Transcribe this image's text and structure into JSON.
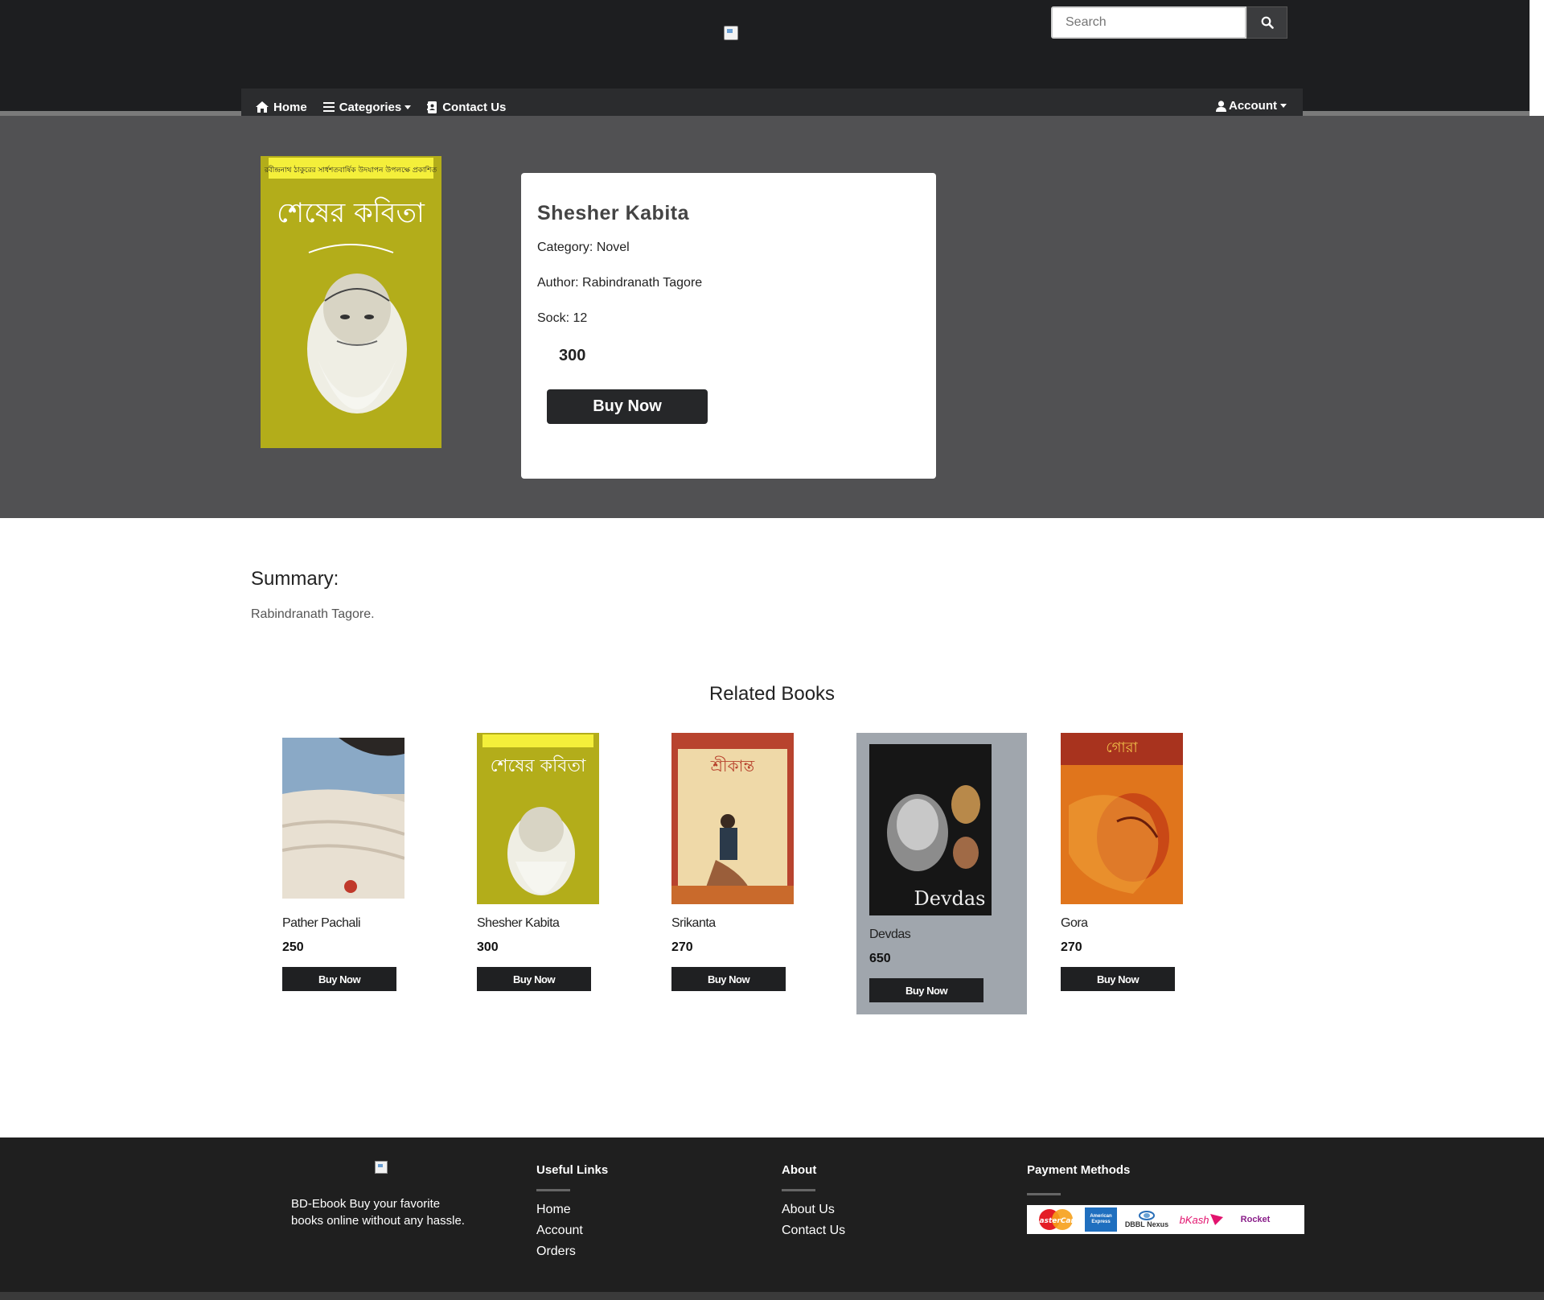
{
  "header": {
    "search_placeholder": "Search",
    "nav": {
      "home": "Home",
      "categories": "Categories",
      "contact": "Contact Us",
      "account": "Account"
    }
  },
  "book": {
    "title": "Shesher Kabita",
    "category": "Category: Novel",
    "author": "Author: Rabindranath Tagore",
    "stock": "Sock: 12",
    "price": "300",
    "buy_label": "Buy Now",
    "cover_title_bn": "শেষের কবিতা",
    "cover_banner_bn": "রবীন্দ্রনাথ ঠাকুরের সার্ধশতবার্ষিক উদযাপন উপলক্ষে প্রকাশিত"
  },
  "summary": {
    "heading": "Summary:",
    "text": "Rabindranath Tagore."
  },
  "related": {
    "heading": "Related Books",
    "items": [
      {
        "name": "Pather Pachali",
        "price": "250",
        "buy_label": "Buy Now",
        "cover": "pather"
      },
      {
        "name": "Shesher Kabita",
        "price": "300",
        "buy_label": "Buy Now",
        "cover": "shesher"
      },
      {
        "name": "Srikanta",
        "price": "270",
        "buy_label": "Buy Now",
        "cover": "srikanta"
      },
      {
        "name": "Devdas",
        "price": "650",
        "buy_label": "Buy Now",
        "cover": "devdas"
      },
      {
        "name": "Gora",
        "price": "270",
        "buy_label": "Buy Now",
        "cover": "gora"
      }
    ]
  },
  "footer": {
    "description": "BD-Ebook Buy your favorite books online without any hassle.",
    "useful_links_title": "Useful Links",
    "useful_links": [
      "Home",
      "Account",
      "Orders"
    ],
    "about_title": "About",
    "about_links": [
      "About Us",
      "Contact Us"
    ],
    "payment_title": "Payment Methods",
    "payments": [
      "MasterCard",
      "American Express",
      "DBBL Nexus",
      "bKash",
      "Rocket"
    ]
  },
  "colors": {
    "header_bg": "#1d1e20",
    "hero_bg": "#515153",
    "button_bg": "#262729",
    "active_card_bg": "#a0a6ad",
    "footer_bg": "#1f1f1f"
  }
}
